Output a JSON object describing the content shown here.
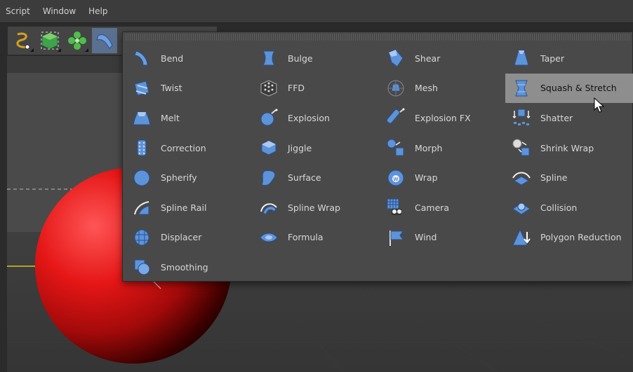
{
  "menu": {
    "items": [
      "Script",
      "Window",
      "Help"
    ]
  },
  "toolbar": {
    "buttons": [
      {
        "icon": "spline-tool-icon"
      },
      {
        "icon": "cube-tool-icon"
      },
      {
        "icon": "array-tool-icon"
      },
      {
        "icon": "bend-tool-icon",
        "active": true
      }
    ]
  },
  "deformers": {
    "columns": [
      [
        {
          "label": "Bend",
          "icon": "bend-icon"
        },
        {
          "label": "Twist",
          "icon": "twist-icon"
        },
        {
          "label": "Melt",
          "icon": "melt-icon"
        },
        {
          "label": "Correction",
          "icon": "correction-icon"
        },
        {
          "label": "Spherify",
          "icon": "spherify-icon"
        },
        {
          "label": "Spline Rail",
          "icon": "spline-rail-icon"
        },
        {
          "label": "Displacer",
          "icon": "displacer-icon"
        },
        {
          "label": "Smoothing",
          "icon": "smoothing-icon"
        }
      ],
      [
        {
          "label": "Bulge",
          "icon": "bulge-icon"
        },
        {
          "label": "FFD",
          "icon": "ffd-icon"
        },
        {
          "label": "Explosion",
          "icon": "explosion-icon"
        },
        {
          "label": "Jiggle",
          "icon": "jiggle-icon"
        },
        {
          "label": "Surface",
          "icon": "surface-icon"
        },
        {
          "label": "Spline Wrap",
          "icon": "spline-wrap-icon"
        },
        {
          "label": "Formula",
          "icon": "formula-icon"
        }
      ],
      [
        {
          "label": "Shear",
          "icon": "shear-icon"
        },
        {
          "label": "Mesh",
          "icon": "mesh-icon"
        },
        {
          "label": "Explosion FX",
          "icon": "explosion-fx-icon"
        },
        {
          "label": "Morph",
          "icon": "morph-icon"
        },
        {
          "label": "Wrap",
          "icon": "wrap-icon"
        },
        {
          "label": "Camera",
          "icon": "camera-icon"
        },
        {
          "label": "Wind",
          "icon": "wind-icon"
        }
      ],
      [
        {
          "label": "Taper",
          "icon": "taper-icon"
        },
        {
          "label": "Squash & Stretch",
          "icon": "squash-stretch-icon",
          "highlighted": true
        },
        {
          "label": "Shatter",
          "icon": "shatter-icon"
        },
        {
          "label": "Shrink Wrap",
          "icon": "shrink-wrap-icon"
        },
        {
          "label": "Spline",
          "icon": "spline-icon"
        },
        {
          "label": "Collision",
          "icon": "collision-icon"
        },
        {
          "label": "Polygon Reduction",
          "icon": "polygon-reduction-icon"
        }
      ]
    ]
  },
  "colors": {
    "icon_blue": "#5b8fd8",
    "highlight": "#8e8e8e",
    "sphere_red": "#e51616"
  }
}
